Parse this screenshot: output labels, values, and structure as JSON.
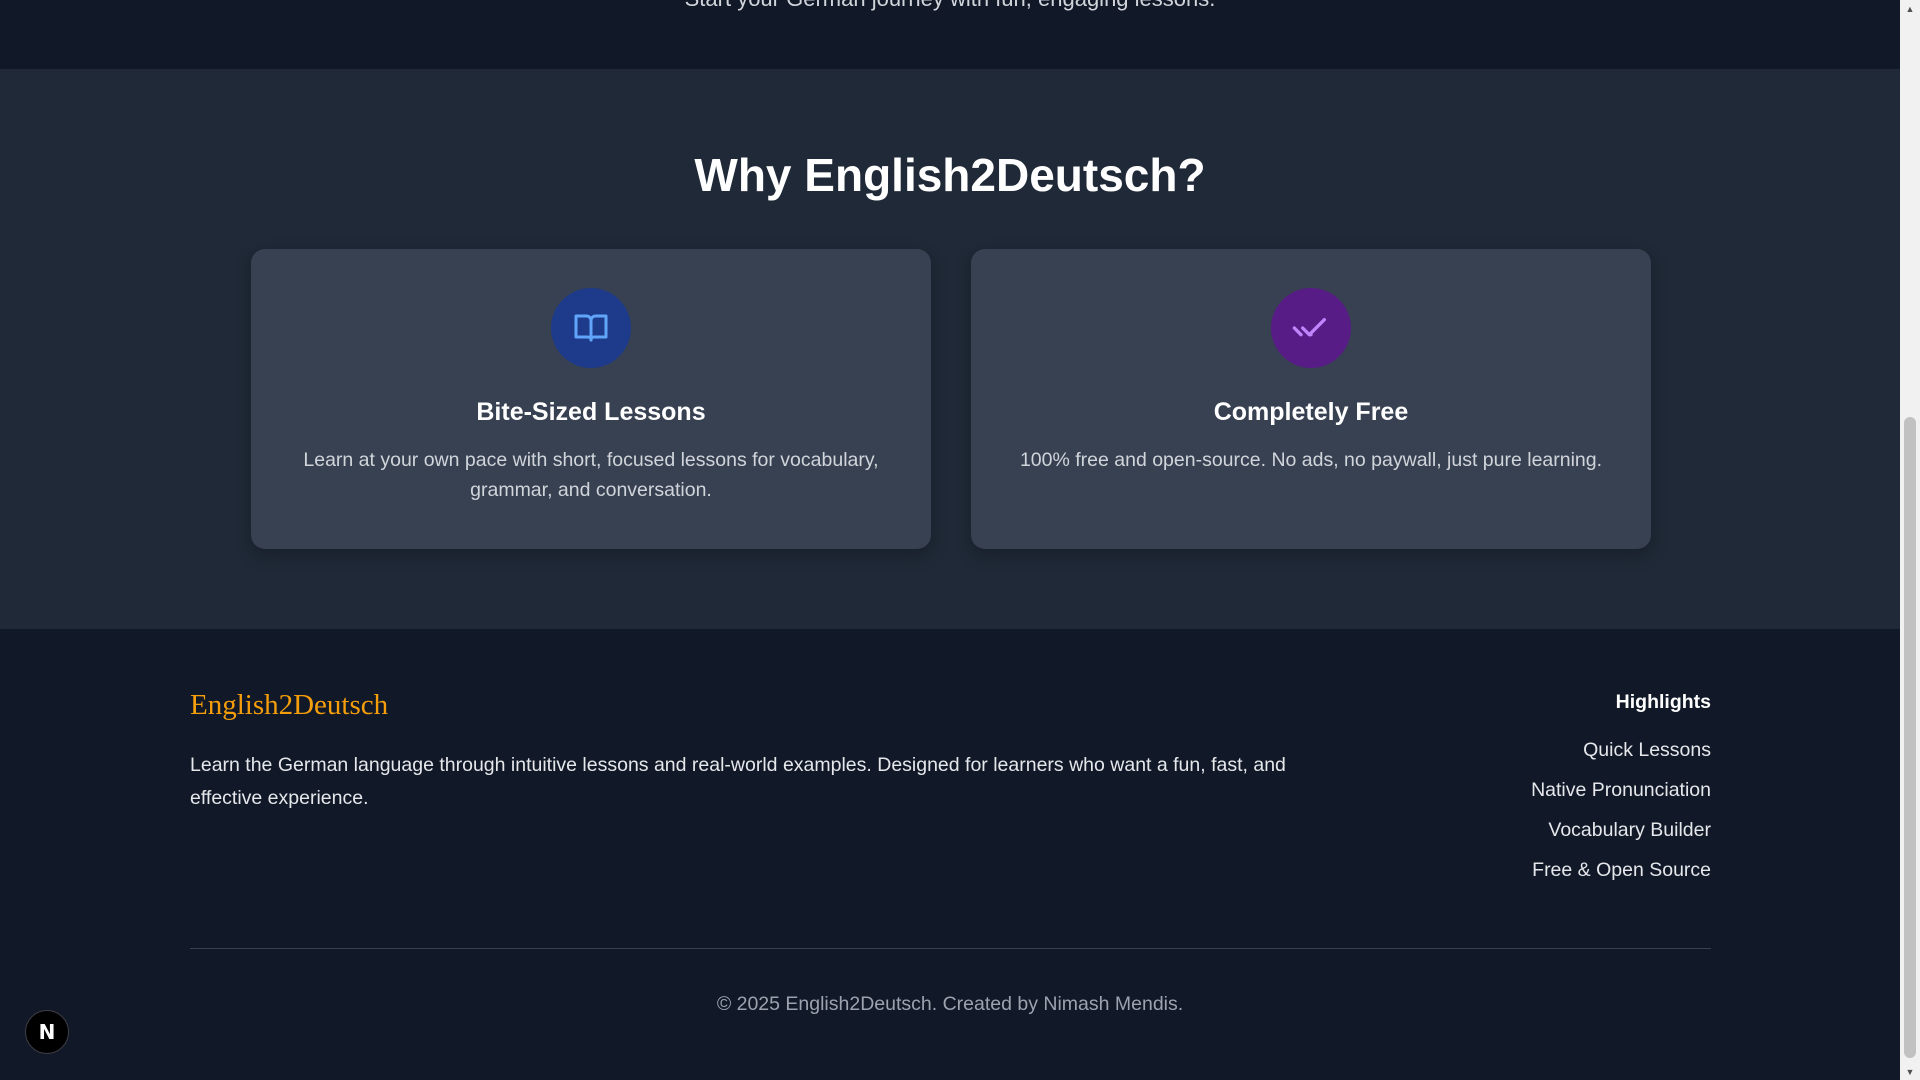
{
  "hero": {
    "cut_text": "Start your German journey with fun, engaging lessons."
  },
  "features": {
    "heading": "Why English2Deutsch?",
    "cards": [
      {
        "icon": "book-open-icon",
        "icon_bg": "#1e3a8a",
        "icon_color": "#60a5fa",
        "title": "Bite-Sized Lessons",
        "description": "Learn at your own pace with short, focused lessons for vocabulary, grammar, and conversation."
      },
      {
        "icon": "double-check-icon",
        "icon_bg": "#581c87",
        "icon_color": "#c084fc",
        "title": "Completely Free",
        "description": "100% free and open-source. No ads, no paywall, just pure learning."
      }
    ]
  },
  "footer": {
    "brand": "English2Deutsch",
    "brand_color": "#f59e0b",
    "about": "Learn the German language through intuitive lessons and real-world examples. Designed for learners who want a fun, fast, and effective experience.",
    "highlights": {
      "title": "Highlights",
      "items": [
        "Quick Lessons",
        "Native Pronunciation",
        "Vocabulary Builder",
        "Free & Open Source"
      ]
    },
    "copyright": "© 2025 English2Deutsch. Created by Nimash Mendis."
  },
  "badge": {
    "label": "N",
    "icon": "nextjs-icon"
  }
}
